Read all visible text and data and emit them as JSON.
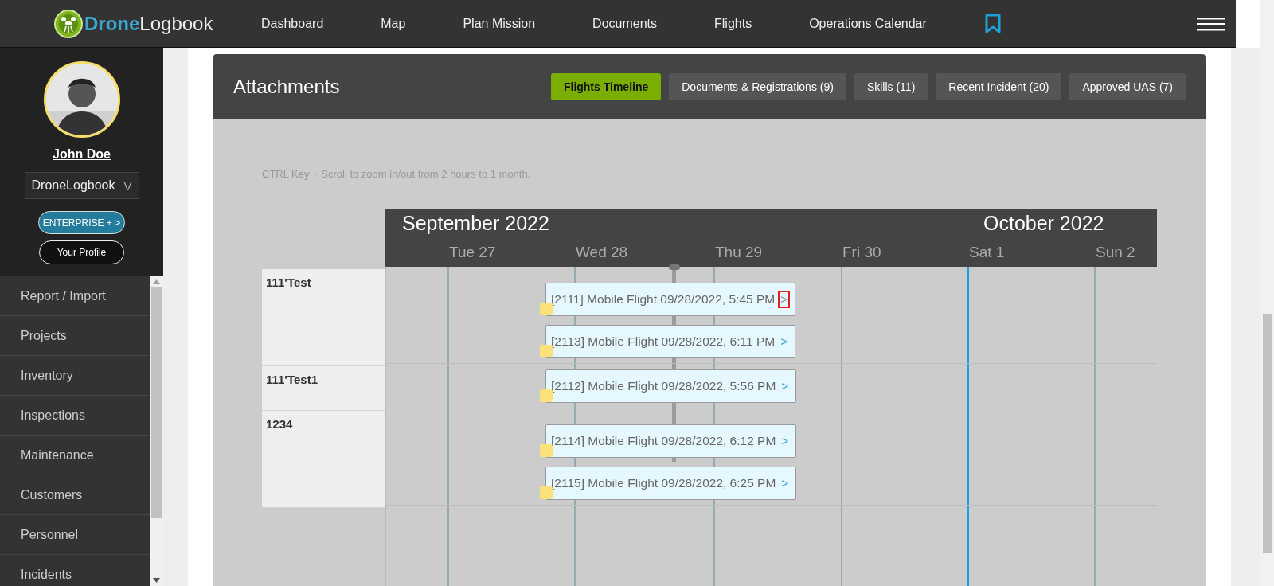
{
  "topbar": {
    "logo": {
      "part_1": "Drone",
      "part_2": "Logbook"
    },
    "nav": [
      {
        "label": "Dashboard"
      },
      {
        "label": "Map"
      },
      {
        "label": "Plan Mission"
      },
      {
        "label": "Documents"
      },
      {
        "label": "Flights"
      },
      {
        "label": "Operations Calendar"
      }
    ]
  },
  "profile": {
    "name": "John Doe",
    "organization": "DroneLogbook",
    "dropdown_caret": "V",
    "plan_button": "ENTERPRISE + >",
    "profile_button": "Your Profile"
  },
  "sidebar": {
    "items": [
      "Report / Import",
      "Projects",
      "Inventory",
      "Inspections",
      "Maintenance",
      "Customers",
      "Personnel",
      "Incidents"
    ]
  },
  "attachments": {
    "title": "Attachments",
    "tabs": [
      {
        "label": "Flights Timeline",
        "selected": true
      },
      {
        "label": "Documents & Registrations (9)",
        "selected": false
      },
      {
        "label": "Skills (11)",
        "selected": false
      },
      {
        "label": "Recent Incident (20)",
        "selected": false
      },
      {
        "label": "Approved UAS (7)",
        "selected": false
      }
    ],
    "hint": "CTRL Key + Scroll to zoom in/out from 2 hours to 1 month.",
    "timeline": {
      "months": [
        "September 2022",
        "October 2022"
      ],
      "days": [
        {
          "label": "Tue 27",
          "accent": false
        },
        {
          "label": "Wed 28",
          "accent": false
        },
        {
          "label": "Thu 29",
          "accent": false
        },
        {
          "label": "Fri 30",
          "accent": false
        },
        {
          "label": "Sat 1",
          "accent": true
        },
        {
          "label": "Sun 2",
          "accent": false
        }
      ],
      "groups": [
        {
          "name": "111'Test",
          "items": [
            {
              "label": "[2111] Mobile Flight 09/28/2022, 5:45 PM",
              "link": ">",
              "highlighted": true
            },
            {
              "label": "[2113] Mobile Flight 09/28/2022, 6:11 PM",
              "link": ">",
              "highlighted": false
            }
          ]
        },
        {
          "name": "111'Test1",
          "items": [
            {
              "label": "[2112] Mobile Flight 09/28/2022, 5:56 PM",
              "link": ">",
              "highlighted": false
            }
          ]
        },
        {
          "name": "1234",
          "items": [
            {
              "label": "[2114] Mobile Flight 09/28/2022, 6:12 PM",
              "link": ">",
              "highlighted": false
            },
            {
              "label": "[2115] Mobile Flight 09/28/2022, 6:25 PM",
              "link": ">",
              "highlighted": false
            }
          ]
        }
      ]
    }
  }
}
